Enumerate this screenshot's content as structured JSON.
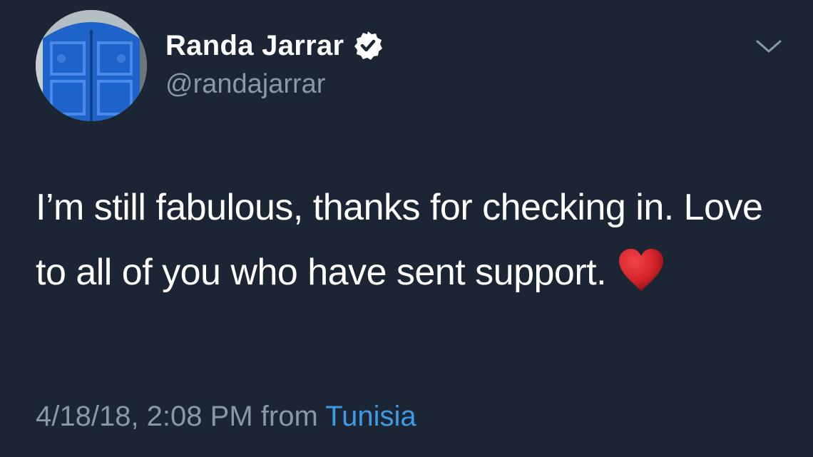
{
  "author": {
    "display_name": "Randa Jarrar",
    "handle": "@randajarrar",
    "verified": true,
    "avatar_icon": "blue-door-avatar"
  },
  "tweet": {
    "text": "I’m still fabulous, thanks for checking in. Love to all of you who have sent support.",
    "emoji": "red-heart-icon"
  },
  "meta": {
    "timestamp": "4/18/18, 2:08 PM",
    "from_label": "from",
    "location": "Tunisia"
  },
  "colors": {
    "background": "#1c2533",
    "text_primary": "#ffffff",
    "text_secondary": "#8899a6",
    "link": "#3f9ae6",
    "heart": "#d4252a"
  }
}
